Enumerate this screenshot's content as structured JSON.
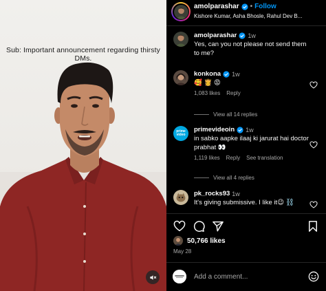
{
  "video": {
    "caption": "Sub: Important announcement regarding thirsty DMs.",
    "mute_icon": "speaker-muted-icon"
  },
  "post": {
    "author": "amolparashar",
    "follow_label": "Follow",
    "separator": "•",
    "audio": "Kishore Kumar, Asha Bhosle, Rahul Dev B...",
    "caption_text": "Yes, can you not please not send them to me?",
    "caption_time": "1w",
    "likes": "50,766 likes",
    "date": "May 28"
  },
  "comments": [
    {
      "user": "konkona",
      "time": "1w",
      "text": "🥰 👸 😡",
      "likes": "1,083 likes",
      "reply": "Reply",
      "view_replies": "View all 14 replies"
    },
    {
      "user": "primevideoin",
      "time": "1w",
      "text": "in sabko aapke ilaaj ki jarurat hai doctor prabhat 👀",
      "likes": "1,119 likes",
      "reply": "Reply",
      "translate": "See translation",
      "view_replies": "View all 4 replies",
      "avatar_text": "prime video"
    },
    {
      "user": "pk_rocks93",
      "time": "1w",
      "text": "It's giving submissive. I like it😉 ⛓️"
    }
  ],
  "add_comment": {
    "placeholder": "Add a comment..."
  },
  "colors": {
    "link": "#0095f6",
    "verified": "#0095f6",
    "muted_text": "#a8a8a8",
    "prime_blue": "#00a8e1"
  }
}
